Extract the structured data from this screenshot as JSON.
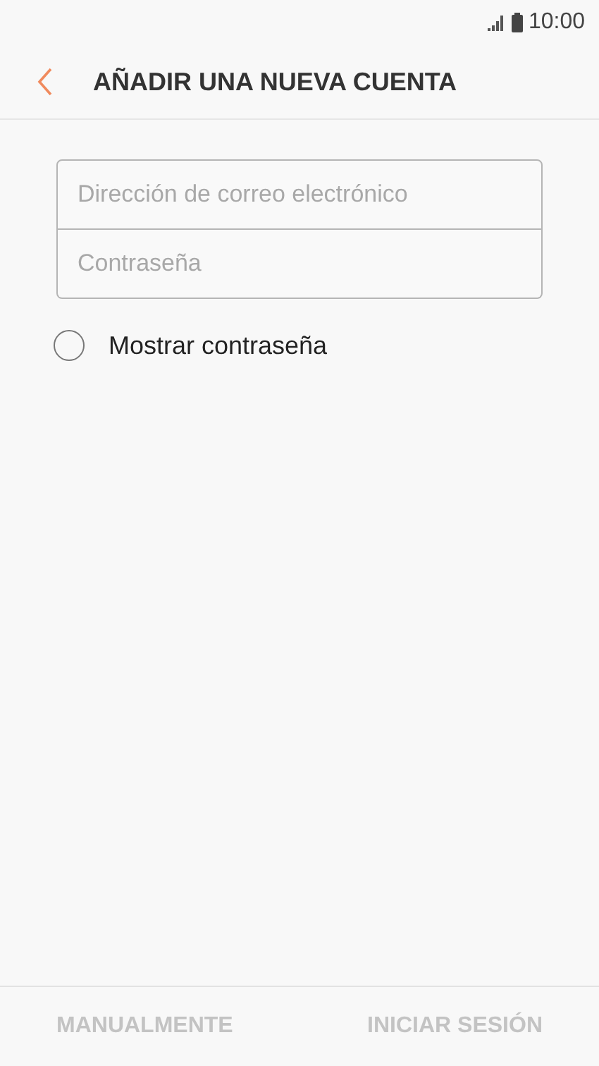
{
  "status_bar": {
    "time": "10:00"
  },
  "header": {
    "title": "AÑADIR UNA NUEVA CUENTA"
  },
  "fields": [
    {
      "placeholder": "Dirección de correo electrónico"
    },
    {
      "placeholder": "Contraseña"
    }
  ],
  "show_password": {
    "label": "Mostrar contraseña",
    "checked": false
  },
  "buttons": [
    {
      "label": "MANUALMENTE",
      "disabled": true
    },
    {
      "label": "INICIAR SESIÓN",
      "disabled": true
    }
  ]
}
